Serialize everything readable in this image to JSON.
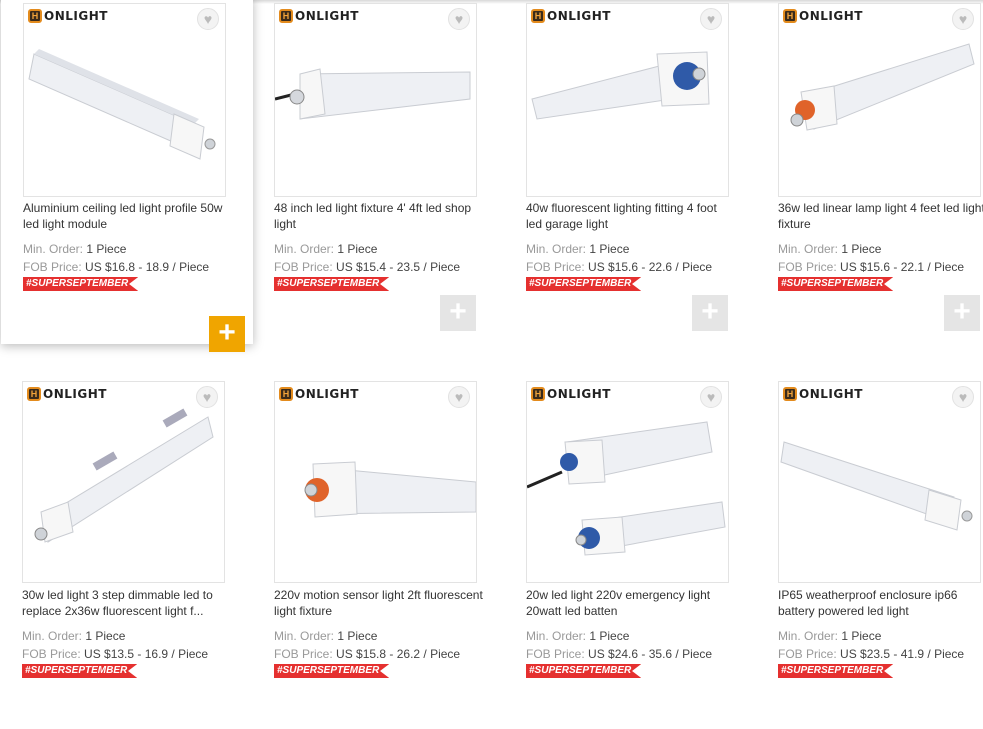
{
  "labels": {
    "brand": "ONLIGHT",
    "min_order_label": "Min. Order:",
    "fob_label": "FOB Price:",
    "promo_badge": "#SUPERSEPTEMBER",
    "add_symbol": "+",
    "favorite_symbol": "♥"
  },
  "products": [
    {
      "title": "Aluminium ceiling led light profile 50w led light module",
      "min_order": "1 Piece",
      "fob_price": "US $16.8 - 18.9 / Piece"
    },
    {
      "title": "48 inch led light fixture 4' 4ft led shop light",
      "min_order": "1 Piece",
      "fob_price": "US $15.4 - 23.5 / Piece"
    },
    {
      "title": "40w fluorescent lighting fitting 4 foot led garage light",
      "min_order": "1 Piece",
      "fob_price": "US $15.6 - 22.6 / Piece"
    },
    {
      "title": "36w led linear lamp light 4 feet led light fixture",
      "min_order": "1 Piece",
      "fob_price": "US $15.6 - 22.1 / Piece"
    },
    {
      "title": "30w led light 3 step dimmable led to replace 2x36w fluorescent light f...",
      "min_order": "1 Piece",
      "fob_price": "US $13.5 - 16.9 / Piece"
    },
    {
      "title": "220v motion sensor light 2ft fluorescent light fixture",
      "min_order": "1 Piece",
      "fob_price": "US $15.8 - 26.2 / Piece"
    },
    {
      "title": "20w led light 220v emergency light 20watt led batten",
      "min_order": "1 Piece",
      "fob_price": "US $24.6 - 35.6 / Piece"
    },
    {
      "title": "IP65 weatherproof enclosure ip66 battery powered led light",
      "min_order": "1 Piece",
      "fob_price": "US $23.5 - 41.9 / Piece"
    }
  ],
  "colors": {
    "accent_orange": "#f0a500",
    "promo_red": "#e5302f",
    "cap_orange": "#e0632a",
    "cap_blue": "#2f5aa8"
  }
}
